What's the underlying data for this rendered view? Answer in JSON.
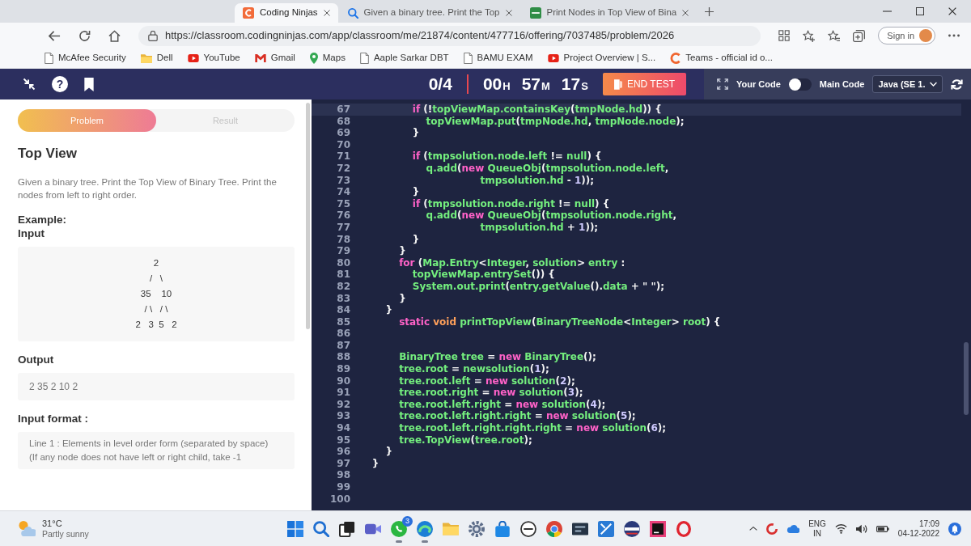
{
  "browser": {
    "tabs": [
      {
        "kind": "cn",
        "title": "Coding Ninjas",
        "selected": true
      },
      {
        "kind": "search",
        "title": "Given a binary tree. Print the Top",
        "selected": false
      },
      {
        "kind": "gfg",
        "title": "Print Nodes in Top View of Bina",
        "selected": false
      }
    ],
    "url": "https://classroom.codingninjas.com/app/classroom/me/21874/content/477716/offering/7037485/problem/2026",
    "sign_in": "Sign in",
    "bookmarks": [
      {
        "kind": "page",
        "label": "McAfee Security"
      },
      {
        "kind": "folder",
        "label": "Dell"
      },
      {
        "kind": "video",
        "label": "YouTube"
      },
      {
        "kind": "mail",
        "label": "Gmail"
      },
      {
        "kind": "pin",
        "label": "Maps"
      },
      {
        "kind": "page",
        "label": "Aaple Sarkar DBT"
      },
      {
        "kind": "page",
        "label": "BAMU EXAM"
      },
      {
        "kind": "video",
        "label": "Project Overview | S..."
      },
      {
        "kind": "logo",
        "label": "Teams - official id o..."
      }
    ]
  },
  "app_header": {
    "help": "?",
    "progress": "0/4",
    "timer": [
      {
        "value": "00",
        "unit": "H"
      },
      {
        "value": "57",
        "unit": "M"
      },
      {
        "value": "17",
        "unit": "S"
      }
    ],
    "end_test": "END TEST"
  },
  "editor_toolbar": {
    "left_label": "Your Code",
    "on": false,
    "right_label": "Main Code",
    "language": "Java (SE 1."
  },
  "problem": {
    "tabs": [
      {
        "label": "Problem",
        "selected": true
      },
      {
        "label": "Result",
        "selected": false
      }
    ],
    "title": "Top View",
    "description": "Given a binary tree. Print the Top View of Binary Tree. Print the nodes from left to right order.",
    "example_heading": "Example:",
    "input_heading": "Input",
    "example_input": [
      "2",
      "/   \\",
      "35    10",
      "/ \\   / \\",
      "2   3  5   2"
    ],
    "output_heading": "Output",
    "output": "2 35 2 10 2",
    "input_format_heading": "Input format :",
    "input_format": [
      "Line 1 : Elements in level order form (separated by space)",
      "(If any node does not have left or right child, take -1"
    ]
  },
  "editor": {
    "lines": [
      {
        "number": "67",
        "current": true,
        "tokens": [
          {
            "text": "                if",
            "kind": "keyword"
          },
          {
            "text": " (!",
            "kind": "punct"
          },
          {
            "text": "topViewMap.containsKey",
            "kind": "name"
          },
          {
            "text": "(",
            "kind": "punct"
          },
          {
            "text": "tmpNode.hd",
            "kind": "name"
          },
          {
            "text": ")) {",
            "kind": "punct"
          }
        ]
      },
      {
        "number": "68",
        "current": false,
        "tokens": [
          {
            "text": "                    topViewMap.put",
            "kind": "name"
          },
          {
            "text": "(",
            "kind": "punct"
          },
          {
            "text": "tmpNode.hd",
            "kind": "name"
          },
          {
            "text": ", ",
            "kind": "punct"
          },
          {
            "text": "tmpNode.node",
            "kind": "name"
          },
          {
            "text": ");",
            "kind": "punct"
          }
        ]
      },
      {
        "number": "69",
        "current": false,
        "tokens": [
          {
            "text": "                }",
            "kind": "punct"
          }
        ]
      },
      {
        "number": "70",
        "current": false
      },
      {
        "number": "71",
        "current": false,
        "tokens": [
          {
            "text": "                if",
            "kind": "keyword"
          },
          {
            "text": " (",
            "kind": "punct"
          },
          {
            "text": "tmpsolution.node.left",
            "kind": "name"
          },
          {
            "text": " != ",
            "kind": "punct"
          },
          {
            "text": "null",
            "kind": "name"
          },
          {
            "text": ") {",
            "kind": "punct"
          }
        ]
      },
      {
        "number": "72",
        "current": false,
        "tokens": [
          {
            "text": "                    q.add",
            "kind": "name"
          },
          {
            "text": "(",
            "kind": "punct"
          },
          {
            "text": "new ",
            "kind": "keyword"
          },
          {
            "text": "QueueObj",
            "kind": "name"
          },
          {
            "text": "(",
            "kind": "punct"
          },
          {
            "text": "tmpsolution.node.left",
            "kind": "name"
          },
          {
            "text": ",",
            "kind": "punct"
          }
        ]
      },
      {
        "number": "73",
        "current": false,
        "tokens": [
          {
            "text": "                                    tmpsolution.hd",
            "kind": "name"
          },
          {
            "text": " - ",
            "kind": "punct"
          },
          {
            "text": "1",
            "kind": "number"
          },
          {
            "text": "));",
            "kind": "punct"
          }
        ]
      },
      {
        "number": "74",
        "current": false,
        "tokens": [
          {
            "text": "                }",
            "kind": "punct"
          }
        ]
      },
      {
        "number": "75",
        "current": false,
        "tokens": [
          {
            "text": "                if",
            "kind": "keyword"
          },
          {
            "text": " (",
            "kind": "punct"
          },
          {
            "text": "tmpsolution.node.right",
            "kind": "name"
          },
          {
            "text": " != ",
            "kind": "punct"
          },
          {
            "text": "null",
            "kind": "name"
          },
          {
            "text": ") {",
            "kind": "punct"
          }
        ]
      },
      {
        "number": "76",
        "current": false,
        "tokens": [
          {
            "text": "                    q.add",
            "kind": "name"
          },
          {
            "text": "(",
            "kind": "punct"
          },
          {
            "text": "new ",
            "kind": "keyword"
          },
          {
            "text": "QueueObj",
            "kind": "name"
          },
          {
            "text": "(",
            "kind": "punct"
          },
          {
            "text": "tmpsolution.node.right",
            "kind": "name"
          },
          {
            "text": ",",
            "kind": "punct"
          }
        ]
      },
      {
        "number": "77",
        "current": false,
        "tokens": [
          {
            "text": "                                    tmpsolution.hd",
            "kind": "name"
          },
          {
            "text": " + ",
            "kind": "punct"
          },
          {
            "text": "1",
            "kind": "number"
          },
          {
            "text": "));",
            "kind": "punct"
          }
        ]
      },
      {
        "number": "78",
        "current": false,
        "tokens": [
          {
            "text": "                }",
            "kind": "punct"
          }
        ]
      },
      {
        "number": "79",
        "current": false,
        "tokens": [
          {
            "text": "            }",
            "kind": "punct"
          }
        ]
      },
      {
        "number": "80",
        "current": false,
        "tokens": [
          {
            "text": "            for",
            "kind": "keyword"
          },
          {
            "text": " (",
            "kind": "punct"
          },
          {
            "text": "Map.Entry",
            "kind": "name"
          },
          {
            "text": "<",
            "kind": "punct"
          },
          {
            "text": "Integer",
            "kind": "name"
          },
          {
            "text": ", ",
            "kind": "punct"
          },
          {
            "text": "solution",
            "kind": "name"
          },
          {
            "text": "> ",
            "kind": "punct"
          },
          {
            "text": "entry",
            "kind": "name"
          },
          {
            "text": " :",
            "kind": "punct"
          }
        ]
      },
      {
        "number": "81",
        "current": false,
        "tokens": [
          {
            "text": "                topViewMap.entrySet",
            "kind": "name"
          },
          {
            "text": "()) {",
            "kind": "punct"
          }
        ]
      },
      {
        "number": "82",
        "current": false,
        "tokens": [
          {
            "text": "                System.out.print",
            "kind": "name"
          },
          {
            "text": "(",
            "kind": "punct"
          },
          {
            "text": "entry.getValue",
            "kind": "name"
          },
          {
            "text": "().",
            "kind": "punct"
          },
          {
            "text": "data",
            "kind": "name"
          },
          {
            "text": " + ",
            "kind": "punct"
          },
          {
            "text": "\" \"",
            "kind": "string"
          },
          {
            "text": ");",
            "kind": "punct"
          }
        ]
      },
      {
        "number": "83",
        "current": false,
        "tokens": [
          {
            "text": "            }",
            "kind": "punct"
          }
        ]
      },
      {
        "number": "84",
        "current": false,
        "tokens": [
          {
            "text": "        }",
            "kind": "punct"
          }
        ]
      },
      {
        "number": "85",
        "current": false,
        "tokens": [
          {
            "text": "            static ",
            "kind": "keyword"
          },
          {
            "text": "void ",
            "kind": "type"
          },
          {
            "text": "printTopView",
            "kind": "name"
          },
          {
            "text": "(",
            "kind": "punct"
          },
          {
            "text": "BinaryTreeNode",
            "kind": "name"
          },
          {
            "text": "<",
            "kind": "punct"
          },
          {
            "text": "Integer",
            "kind": "name"
          },
          {
            "text": "> ",
            "kind": "punct"
          },
          {
            "text": "root",
            "kind": "name"
          },
          {
            "text": ") {",
            "kind": "punct"
          }
        ]
      },
      {
        "number": "86",
        "current": false
      },
      {
        "number": "87",
        "current": false
      },
      {
        "number": "88",
        "current": false,
        "tokens": [
          {
            "text": "            BinaryTree tree",
            "kind": "name"
          },
          {
            "text": " = ",
            "kind": "punct"
          },
          {
            "text": "new ",
            "kind": "keyword"
          },
          {
            "text": "BinaryTree",
            "kind": "name"
          },
          {
            "text": "();",
            "kind": "punct"
          }
        ]
      },
      {
        "number": "89",
        "current": false,
        "tokens": [
          {
            "text": "            tree.root",
            "kind": "name"
          },
          {
            "text": " = ",
            "kind": "punct"
          },
          {
            "text": "newsolution",
            "kind": "name"
          },
          {
            "text": "(",
            "kind": "punct"
          },
          {
            "text": "1",
            "kind": "number"
          },
          {
            "text": ");",
            "kind": "punct"
          }
        ]
      },
      {
        "number": "90",
        "current": false,
        "tokens": [
          {
            "text": "            tree.root.left",
            "kind": "name"
          },
          {
            "text": " = ",
            "kind": "punct"
          },
          {
            "text": "new ",
            "kind": "keyword"
          },
          {
            "text": "solution",
            "kind": "name"
          },
          {
            "text": "(",
            "kind": "punct"
          },
          {
            "text": "2",
            "kind": "number"
          },
          {
            "text": ");",
            "kind": "punct"
          }
        ]
      },
      {
        "number": "91",
        "current": false,
        "tokens": [
          {
            "text": "            tree.root.right",
            "kind": "name"
          },
          {
            "text": " = ",
            "kind": "punct"
          },
          {
            "text": "new ",
            "kind": "keyword"
          },
          {
            "text": "solution",
            "kind": "name"
          },
          {
            "text": "(",
            "kind": "punct"
          },
          {
            "text": "3",
            "kind": "number"
          },
          {
            "text": ");",
            "kind": "punct"
          }
        ]
      },
      {
        "number": "92",
        "current": false,
        "tokens": [
          {
            "text": "            tree.root.left.right",
            "kind": "name"
          },
          {
            "text": " = ",
            "kind": "punct"
          },
          {
            "text": "new ",
            "kind": "keyword"
          },
          {
            "text": "solution",
            "kind": "name"
          },
          {
            "text": "(",
            "kind": "punct"
          },
          {
            "text": "4",
            "kind": "number"
          },
          {
            "text": ");",
            "kind": "punct"
          }
        ]
      },
      {
        "number": "93",
        "current": false,
        "tokens": [
          {
            "text": "            tree.root.left.right.right",
            "kind": "name"
          },
          {
            "text": " = ",
            "kind": "punct"
          },
          {
            "text": "new ",
            "kind": "keyword"
          },
          {
            "text": "solution",
            "kind": "name"
          },
          {
            "text": "(",
            "kind": "punct"
          },
          {
            "text": "5",
            "kind": "number"
          },
          {
            "text": ");",
            "kind": "punct"
          }
        ]
      },
      {
        "number": "94",
        "current": false,
        "tokens": [
          {
            "text": "            tree.root.left.right.right.right",
            "kind": "name"
          },
          {
            "text": " = ",
            "kind": "punct"
          },
          {
            "text": "new ",
            "kind": "keyword"
          },
          {
            "text": "solution",
            "kind": "name"
          },
          {
            "text": "(",
            "kind": "punct"
          },
          {
            "text": "6",
            "kind": "number"
          },
          {
            "text": ");",
            "kind": "punct"
          }
        ]
      },
      {
        "number": "95",
        "current": false,
        "tokens": [
          {
            "text": "            tree.TopView",
            "kind": "name"
          },
          {
            "text": "(",
            "kind": "punct"
          },
          {
            "text": "tree.root",
            "kind": "name"
          },
          {
            "text": ");",
            "kind": "punct"
          }
        ]
      },
      {
        "number": "96",
        "current": false,
        "tokens": [
          {
            "text": "        }",
            "kind": "punct"
          }
        ]
      },
      {
        "number": "97",
        "current": false,
        "tokens": [
          {
            "text": "    }",
            "kind": "punct"
          }
        ]
      },
      {
        "number": "98",
        "current": false
      },
      {
        "number": "99",
        "current": false
      },
      {
        "number": "100",
        "current": false
      }
    ]
  },
  "taskbar": {
    "weather": {
      "temperature": "31°C",
      "condition": "Partly sunny"
    },
    "apps": [
      {
        "kind": "start",
        "running": false
      },
      {
        "kind": "search",
        "running": false
      },
      {
        "kind": "task_view",
        "running": false
      },
      {
        "kind": "meet",
        "running": false
      },
      {
        "kind": "whatsapp",
        "running": true,
        "badge": "3"
      },
      {
        "kind": "edge",
        "running": true
      },
      {
        "kind": "explorer",
        "running": false
      },
      {
        "kind": "settings",
        "running": false
      },
      {
        "kind": "store",
        "running": false
      },
      {
        "kind": "dell",
        "running": false
      },
      {
        "kind": "chrome",
        "running": false
      },
      {
        "kind": "dark_app",
        "running": false
      },
      {
        "kind": "blue_app",
        "running": false
      },
      {
        "kind": "round_app",
        "running": false
      },
      {
        "kind": "ide",
        "running": false
      },
      {
        "kind": "opera",
        "running": false
      }
    ],
    "language": "ENG",
    "region": "IN",
    "time": "17:09",
    "date": "04-12-2022"
  }
}
